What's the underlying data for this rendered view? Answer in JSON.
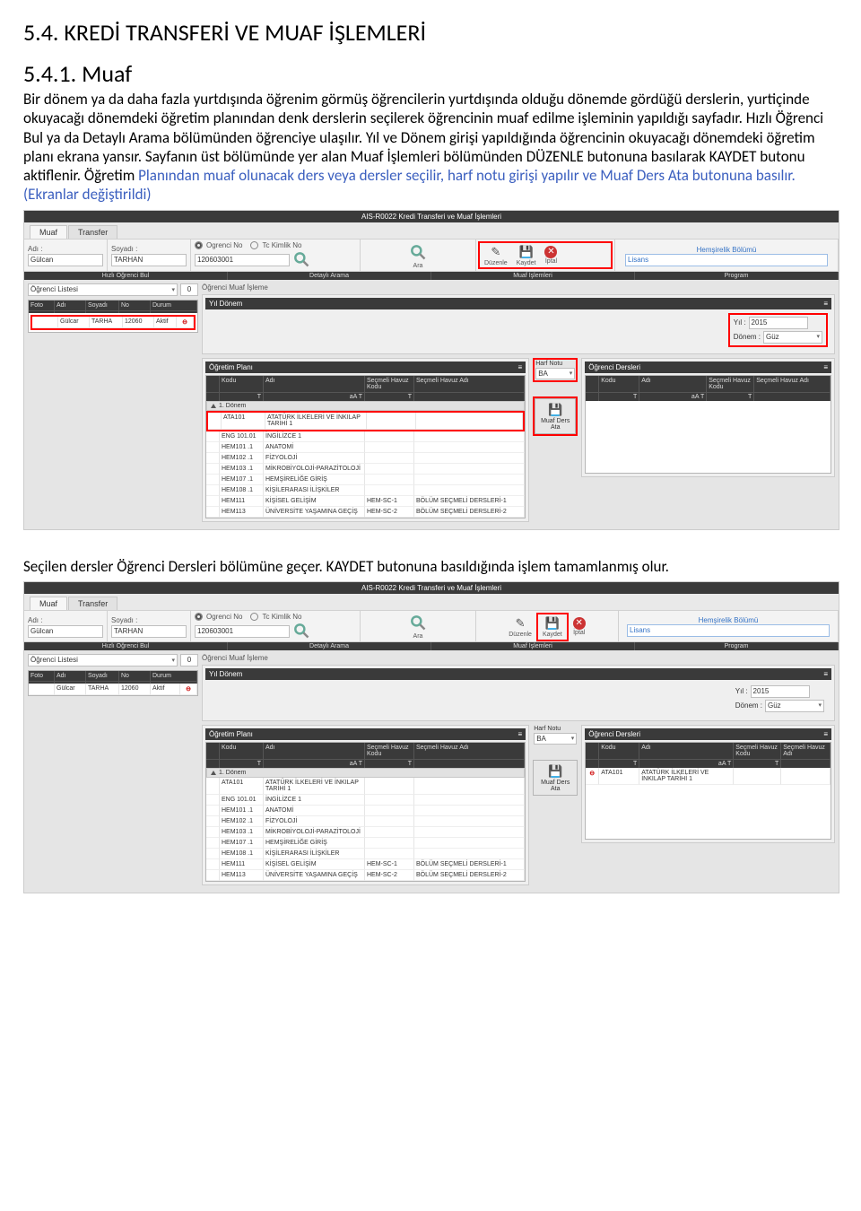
{
  "headings": {
    "h1": "5.4. KREDİ TRANSFERİ VE MUAF İŞLEMLERİ",
    "h2": "5.4.1. Muaf"
  },
  "para": {
    "p1": "Bir dönem ya da daha fazla yurtdışında öğrenim görmüş öğrencilerin yurtdışında olduğu dönemde gördüğü derslerin, yurtiçinde okuyacağı dönemdeki öğretim planından denk derslerin seçilerek öğrencinin muaf edilme işleminin yapıldığı sayfadır. Hızlı Öğrenci Bul ya da Detaylı Arama bölümünden öğrenciye ulaşılır. Yıl ve Dönem girişi yapıldığında öğrencinin okuyacağı dönemdeki öğretim planı ekrana yansır. Sayfanın üst bölümünde yer alan Muaf İşlemleri bölümünden DÜZENLE butonuna basılarak KAYDET butonu aktiflenir. Öğretim ",
    "p1b": "Planından muaf olunacak ders veya dersler seçilir, harf notu girişi yapılır ve Muaf Ders Ata butonuna basılır. (Ekranlar değiştirildi)",
    "p2": "Seçilen dersler Öğrenci Dersleri bölümüne geçer. KAYDET butonuna basıldığında işlem tamamlanmış olur."
  },
  "app": {
    "title": "AIS-R0022 Kredi Transferi ve Muaf İşlemleri",
    "tabs": {
      "t1": "Muaf",
      "t2": "Transfer"
    },
    "fields": {
      "adi": "Adı :",
      "soyadi": "Soyadı :",
      "ogno": "Ogrenci No",
      "tc": "Tc Kimlik No",
      "ara": "Ara",
      "duzenle": "Düzenle",
      "kaydet": "Kaydet",
      "iptal": "İptal"
    },
    "vals": {
      "adi": "Gülcan",
      "soyadi": "TARHAN",
      "no": "120603001"
    },
    "prog": {
      "bolum": "Hemşirelik Bölümü",
      "tip": "Lisans"
    },
    "strip": {
      "a": "Hızlı Öğrenci Bul",
      "b": "Detaylı Arama",
      "c": "Muaf İşlemleri",
      "d": "Program"
    },
    "listesi": "Öğrenci Listesi",
    "zero": "0",
    "muafisleme": "Öğrenci Muaf İşleme",
    "listcols": {
      "foto": "Foto",
      "adi": "Adı",
      "soyadi": "Soyadı",
      "no": "No",
      "durum": "Durum"
    },
    "listrow": {
      "adi": "Gülcar",
      "soyadi": "TARHA",
      "no": "12060",
      "durum": "Aktif"
    },
    "yildonem": {
      "title": "Yıl Dönem",
      "yil": "Yıl :",
      "yilv": "2015",
      "donem": "Dönem :",
      "donemv": "Güz"
    },
    "ogretim": {
      "title": "Öğretim Planı"
    },
    "ogrders": {
      "title": "Öğrenci Dersleri"
    },
    "plancols": {
      "kodu": "Kodu",
      "adi": "Adı",
      "sh": "Seçmeli Havuz Kodu",
      "sha": "Seçmeli Havuz Adı"
    },
    "filter": {
      "aa": "aA",
      "t": "T"
    },
    "donemhdr": "1. Dönem",
    "harf": {
      "lbl": "Harf Notu",
      "val": "BA"
    },
    "dersata": "Muaf Ders Ata",
    "courses": [
      {
        "k": "ATA101",
        "a": "ATATÜRK İLKELERİ VE İNKILAP TARİHİ 1"
      },
      {
        "k": "ENG 101.01",
        "a": "İNGİLİZCE 1"
      },
      {
        "k": "HEM101 .1",
        "a": "ANATOMİ"
      },
      {
        "k": "HEM102 .1",
        "a": "FİZYOLOJİ"
      },
      {
        "k": "HEM103 .1",
        "a": "MİKROBİYOLOJİ-PARAZİTOLOJİ"
      },
      {
        "k": "HEM107 .1",
        "a": "HEMŞİRELİĞE GİRİŞ"
      },
      {
        "k": "HEM108 .1",
        "a": "KİŞİLERARASI İLİŞKİLER"
      },
      {
        "k": "HEM111",
        "a": "KİŞİSEL GELİŞİM",
        "sh": "HEM-SC-1",
        "sha": "BÖLÜM SEÇMELİ DERSLERİ-1"
      },
      {
        "k": "HEM113",
        "a": "ÜNİVERSİTE YAŞAMINA GEÇİŞ",
        "sh": "HEM-SC-2",
        "sha": "BÖLÜM SEÇMELİ DERSLERİ-2"
      }
    ],
    "ogrrow": {
      "k": "ATA101",
      "a": "ATATÜRK İLKELERİ VE İNKILAP TARİHİ 1"
    }
  }
}
